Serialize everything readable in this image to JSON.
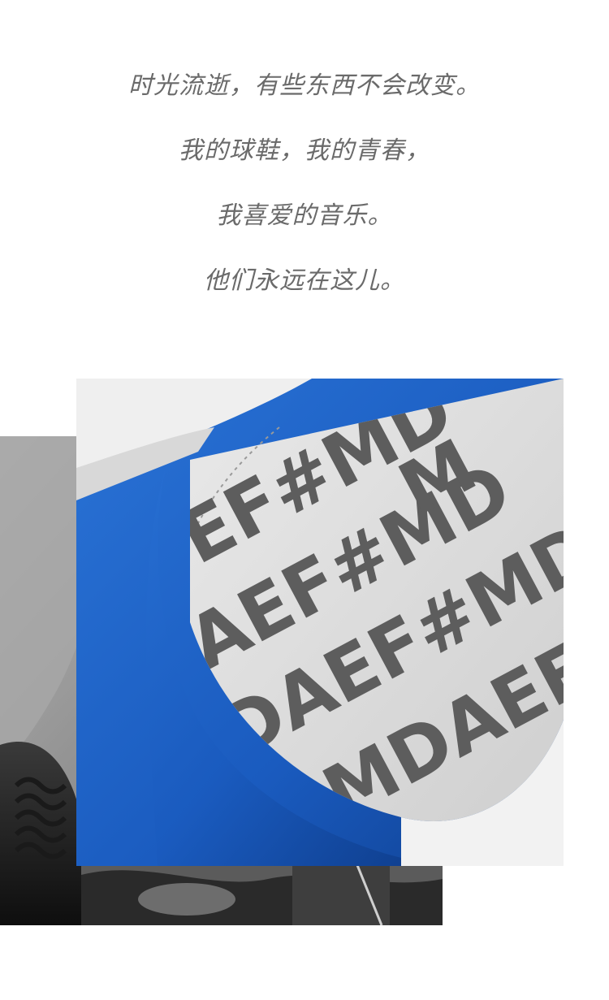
{
  "poem": {
    "line1": "时光流逝，有些东西不会改变。",
    "line2": "我的球鞋，我的青春，",
    "line3": "我喜爱的音乐。",
    "line4": "他们永远在这儿。"
  },
  "photos": {
    "background": {
      "icon": "grayscale-hands-headphones-photo",
      "tone": "#7a7a7a"
    },
    "foreground": {
      "icon": "blue-sneaker-insole-photo",
      "accent": "#1d5fc0",
      "print_letters": "AEF#MD"
    }
  }
}
